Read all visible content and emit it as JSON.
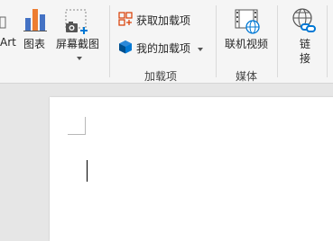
{
  "ribbon": {
    "smartart_label_partial": "Art",
    "chart_label": "图表",
    "screenshot_label": "屏幕截图",
    "get_addins_label": "获取加载项",
    "my_addins_label": "我的加载项",
    "addins_group_label": "加载项",
    "online_video_label": "联机视频",
    "media_group_label": "媒体",
    "link_label_line1": "链",
    "link_label_line2": "接"
  },
  "colors": {
    "chart_bar_blue": "#4472c4",
    "chart_bar_orange": "#ed7d31",
    "addin_red": "#d83b01",
    "addin_blue": "#0078d4"
  }
}
